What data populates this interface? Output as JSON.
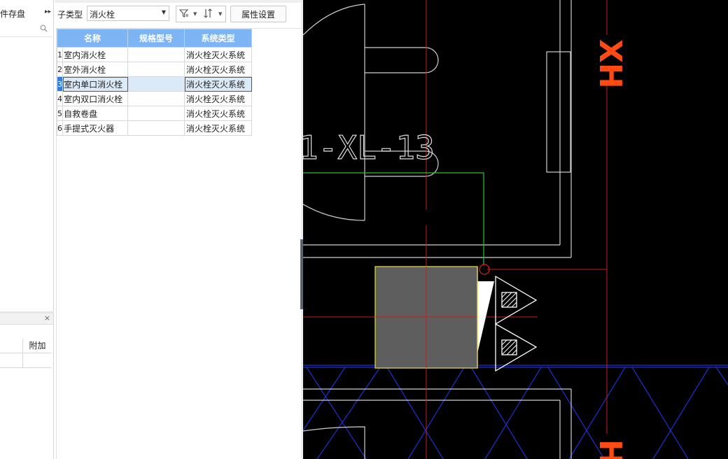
{
  "left_panel": {
    "top_tab_label": "件存盘",
    "expand_arrow": "▸▸",
    "search_icon": "⚲",
    "close_icon": "×",
    "sub_table_header": "附加"
  },
  "mid_panel": {
    "subtype_label": "子类型",
    "subtype_value": "消火栓",
    "filter_icon": "filter-icon",
    "sort_icon": "sort-icon",
    "prop_button": "属性设置",
    "table": {
      "columns": [
        "名称",
        "规格型号",
        "系统类型"
      ],
      "selected_index": 2,
      "rows": [
        {
          "idx": "1",
          "name": "室内消火栓",
          "spec": "",
          "system": "消火栓灭火系统"
        },
        {
          "idx": "2",
          "name": "室外消火栓",
          "spec": "",
          "system": "消火栓灭火系统"
        },
        {
          "idx": "3",
          "name": "室内单口消火栓",
          "spec": "",
          "system": "消火栓灭火系统"
        },
        {
          "idx": "4",
          "name": "室内双口消火栓",
          "spec": "",
          "system": "消火栓灭火系统"
        },
        {
          "idx": "5",
          "name": "自救卷盘",
          "spec": "",
          "system": "消火栓灭火系统"
        },
        {
          "idx": "6",
          "name": "手提式灭火器",
          "spec": "",
          "system": "消火栓灭火系统"
        }
      ]
    }
  },
  "cad": {
    "background": "#000000",
    "label_xl": "1-XL-13",
    "label_xh_top": "XH",
    "label_xh_bottom": "H",
    "colors": {
      "wall": "#cfcfcf",
      "axis_red": "#c81e1e",
      "label_orange": "#ff4a14",
      "pipe_green": "#27c43a",
      "hatch_blue": "#1f2fd0",
      "box_fill": "#5e5e5e",
      "box_border": "#e0d13a"
    }
  }
}
